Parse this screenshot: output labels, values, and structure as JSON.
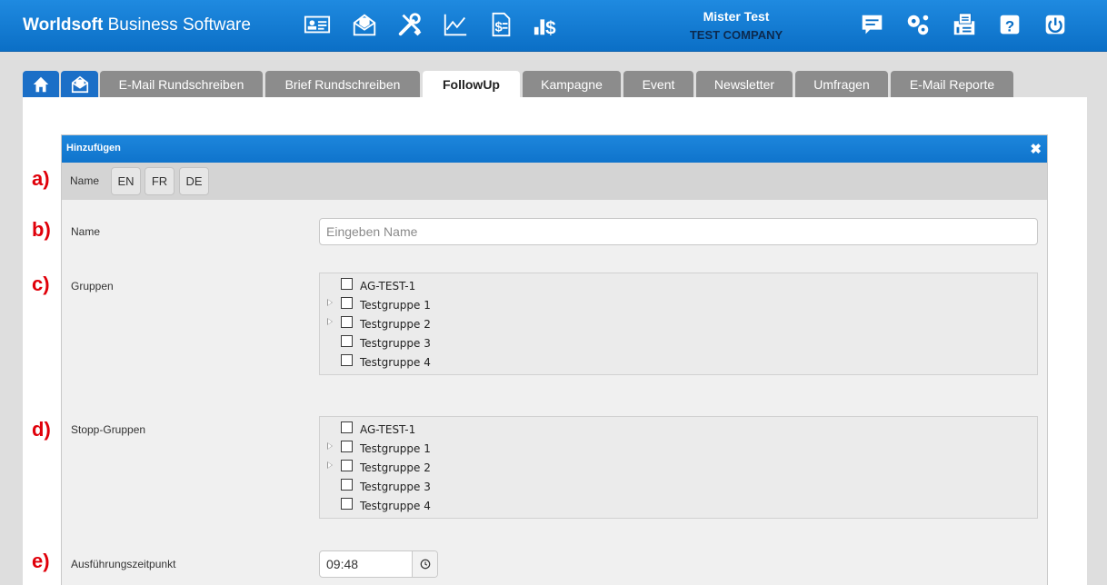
{
  "app": {
    "brand_bold": "Worldsoft",
    "brand_rest": " Business Software"
  },
  "header": {
    "icons": [
      "contact-card-icon",
      "mail-marketing-icon",
      "tools-icon",
      "line-chart-icon",
      "invoice-dollar-icon",
      "bar-dollar-icon"
    ],
    "right_icons": [
      "chat-icon",
      "settings-gears-icon",
      "fax-printer-icon",
      "help-icon",
      "power-icon"
    ],
    "user_name": "Mister Test",
    "company": "TEST COMPANY"
  },
  "tabs": [
    {
      "label": "E-Mail Rundschreiben"
    },
    {
      "label": "Brief Rundschreiben"
    },
    {
      "label": "FollowUp",
      "active": true
    },
    {
      "label": "Kampagne"
    },
    {
      "label": "Event"
    },
    {
      "label": "Newsletter"
    },
    {
      "label": "Umfragen"
    },
    {
      "label": "E-Mail Reporte"
    }
  ],
  "dialog": {
    "title": "Hinzufügen",
    "close": "✖",
    "lang_label": "Name",
    "languages": [
      "EN",
      "FR",
      "DE"
    ],
    "name_label": "Name",
    "name_placeholder": "Eingeben Name",
    "groups_label": "Gruppen",
    "stop_groups_label": "Stopp-Gruppen",
    "groups": [
      {
        "label": "AG-TEST-1",
        "expandable": false
      },
      {
        "label": "Testgruppe 1",
        "expandable": true
      },
      {
        "label": "Testgruppe 2",
        "expandable": true
      },
      {
        "label": "Testgruppe 3",
        "expandable": false
      },
      {
        "label": "Testgruppe 4",
        "expandable": false
      }
    ],
    "stop_groups": [
      {
        "label": "AG-TEST-1",
        "expandable": false
      },
      {
        "label": "Testgruppe 1",
        "expandable": true
      },
      {
        "label": "Testgruppe 2",
        "expandable": true
      },
      {
        "label": "Testgruppe 3",
        "expandable": false
      },
      {
        "label": "Testgruppe 4",
        "expandable": false
      }
    ],
    "time_label": "Ausführungszeitpunkt",
    "time_value": "09:48"
  },
  "annotations": [
    "a)",
    "b)",
    "c)",
    "d)",
    "e)"
  ],
  "colors": {
    "header_blue": "#0b6fc6",
    "annotation_red": "#e0000a",
    "tab_grey": "#8c8c8c"
  }
}
